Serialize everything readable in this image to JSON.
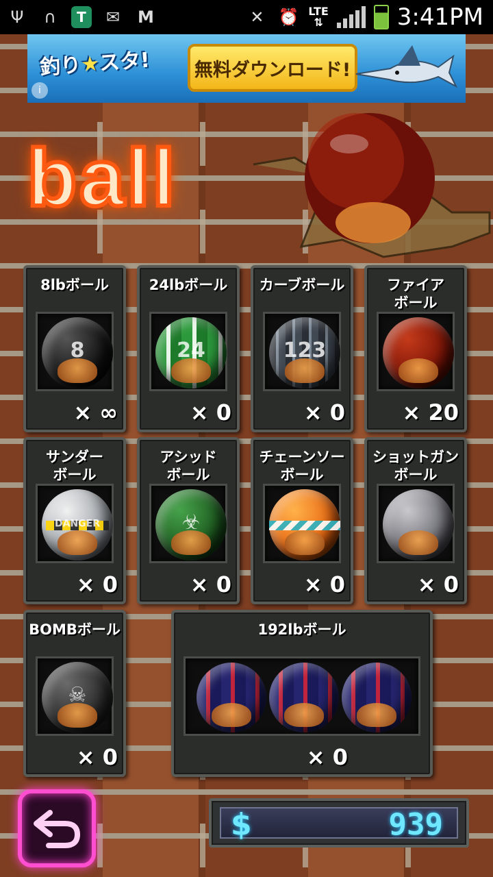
{
  "status_bar": {
    "time": "3:41PM",
    "network": "LTE",
    "icons": [
      "usb-icon",
      "headset-icon",
      "shield-app-icon",
      "message-icon",
      "gmail-icon",
      "mute-icon",
      "alarm-icon",
      "signal-icon",
      "battery-icon"
    ]
  },
  "ad": {
    "logo_text": "釣り",
    "logo_text_2": "スタ!",
    "cta_label": "無料ダウンロード!",
    "colors": {
      "sky": "#2c8fd6",
      "button": "#f3b619"
    }
  },
  "title": "ball",
  "balls": [
    {
      "name": "8lbボール",
      "count": "× ∞",
      "style": "8",
      "glyph": "8"
    },
    {
      "name": "24lbボール",
      "count": "× 0",
      "style": "24",
      "glyph": "24"
    },
    {
      "name": "カーブボール",
      "count": "× 0",
      "style": "curve",
      "glyph": "123"
    },
    {
      "name": "ファイア\nボール",
      "count": "× 20",
      "style": "fire",
      "glyph": ""
    },
    {
      "name": "サンダー\nボール",
      "count": "× 0",
      "style": "thunder",
      "glyph": "DANGER"
    },
    {
      "name": "アシッド\nボール",
      "count": "× 0",
      "style": "acid",
      "glyph": "☣"
    },
    {
      "name": "チェーンソー\nボール",
      "count": "× 0",
      "style": "chain",
      "glyph": ""
    },
    {
      "name": "ショットガン\nボール",
      "count": "× 0",
      "style": "shot",
      "glyph": ""
    },
    {
      "name": "BOMBボール",
      "count": "× 0",
      "style": "bomb",
      "glyph": "☠"
    }
  ],
  "big_ball": {
    "name": "192lbボール",
    "count": "× 0"
  },
  "money": {
    "symbol": "$",
    "amount": "939"
  },
  "colors": {
    "neon_orange": "#ff5a12",
    "neon_pink": "#ff4fd0",
    "money_cyan": "#6fe8ff"
  }
}
